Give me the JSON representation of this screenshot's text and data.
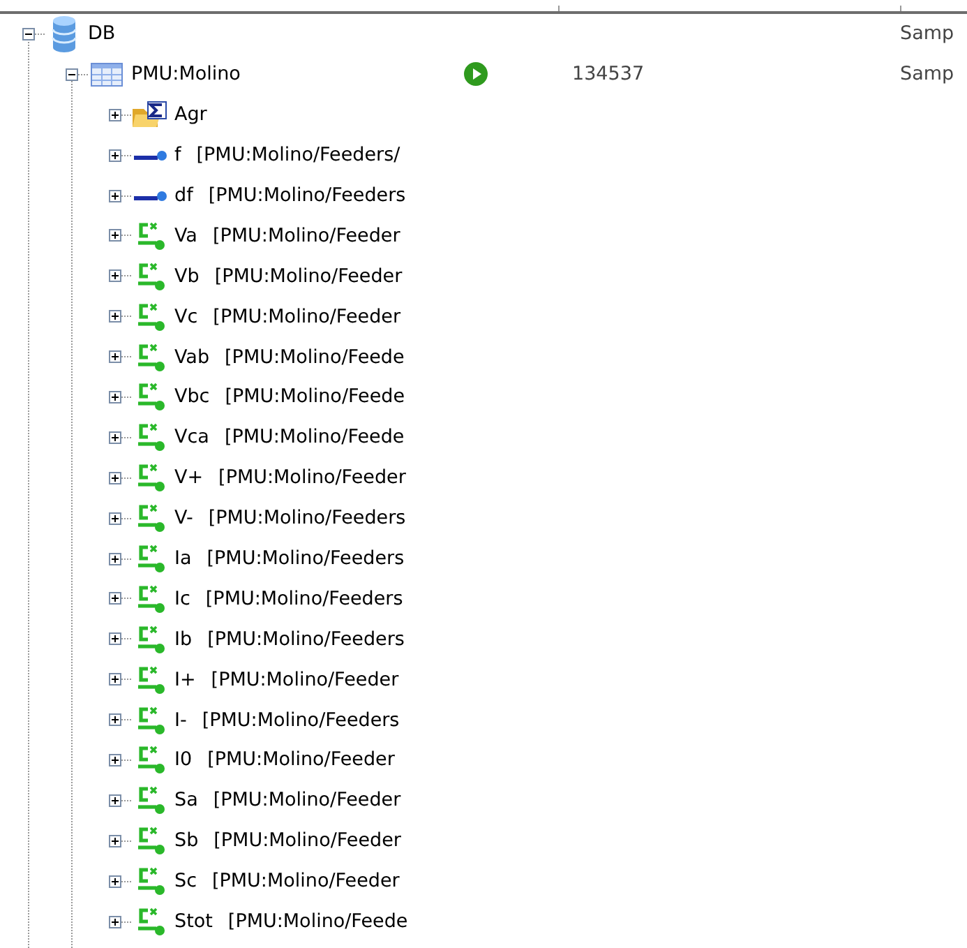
{
  "tree": [
    {
      "label": "DB",
      "kind": "database",
      "expanded": true,
      "column_4": "Samp",
      "children": [
        {
          "label": "PMU:Molino",
          "kind": "table",
          "expanded": true,
          "running": true,
          "column_3": "134537",
          "column_4": "Samp",
          "children": [
            {
              "label": "Agr",
              "kind": "aggregate",
              "expanded": false
            },
            {
              "label": "f",
              "path": "[PMU:Molino/Feeders/",
              "kind": "signal",
              "expanded": false
            },
            {
              "label": "df",
              "path": "[PMU:Molino/Feeders",
              "kind": "signal",
              "expanded": false
            },
            {
              "label": "Va",
              "path": "[PMU:Molino/Feeder",
              "kind": "calc",
              "expanded": false
            },
            {
              "label": "Vb",
              "path": "[PMU:Molino/Feeder",
              "kind": "calc",
              "expanded": false
            },
            {
              "label": "Vc",
              "path": "[PMU:Molino/Feeder",
              "kind": "calc",
              "expanded": false
            },
            {
              "label": "Vab",
              "path": "[PMU:Molino/Feede",
              "kind": "calc",
              "expanded": false
            },
            {
              "label": "Vbc",
              "path": "[PMU:Molino/Feede",
              "kind": "calc",
              "expanded": false
            },
            {
              "label": "Vca",
              "path": "[PMU:Molino/Feede",
              "kind": "calc",
              "expanded": false
            },
            {
              "label": "V+",
              "path": "[PMU:Molino/Feeder",
              "kind": "calc",
              "expanded": false
            },
            {
              "label": "V-",
              "path": "[PMU:Molino/Feeders",
              "kind": "calc",
              "expanded": false
            },
            {
              "label": "Ia",
              "path": "[PMU:Molino/Feeders",
              "kind": "calc",
              "expanded": false
            },
            {
              "label": "Ic",
              "path": "[PMU:Molino/Feeders",
              "kind": "calc",
              "expanded": false
            },
            {
              "label": "Ib",
              "path": "[PMU:Molino/Feeders",
              "kind": "calc",
              "expanded": false
            },
            {
              "label": "I+",
              "path": "[PMU:Molino/Feeder",
              "kind": "calc",
              "expanded": false
            },
            {
              "label": "I-",
              "path": "[PMU:Molino/Feeders",
              "kind": "calc",
              "expanded": false
            },
            {
              "label": "I0",
              "path": "[PMU:Molino/Feeder",
              "kind": "calc",
              "expanded": false
            },
            {
              "label": "Sa",
              "path": "[PMU:Molino/Feeder",
              "kind": "calc",
              "expanded": false
            },
            {
              "label": "Sb",
              "path": "[PMU:Molino/Feeder",
              "kind": "calc",
              "expanded": false
            },
            {
              "label": "Sc",
              "path": "[PMU:Molino/Feeder",
              "kind": "calc",
              "expanded": false
            },
            {
              "label": "Stot",
              "path": "[PMU:Molino/Feede",
              "kind": "calc",
              "expanded": false
            }
          ]
        }
      ]
    }
  ]
}
